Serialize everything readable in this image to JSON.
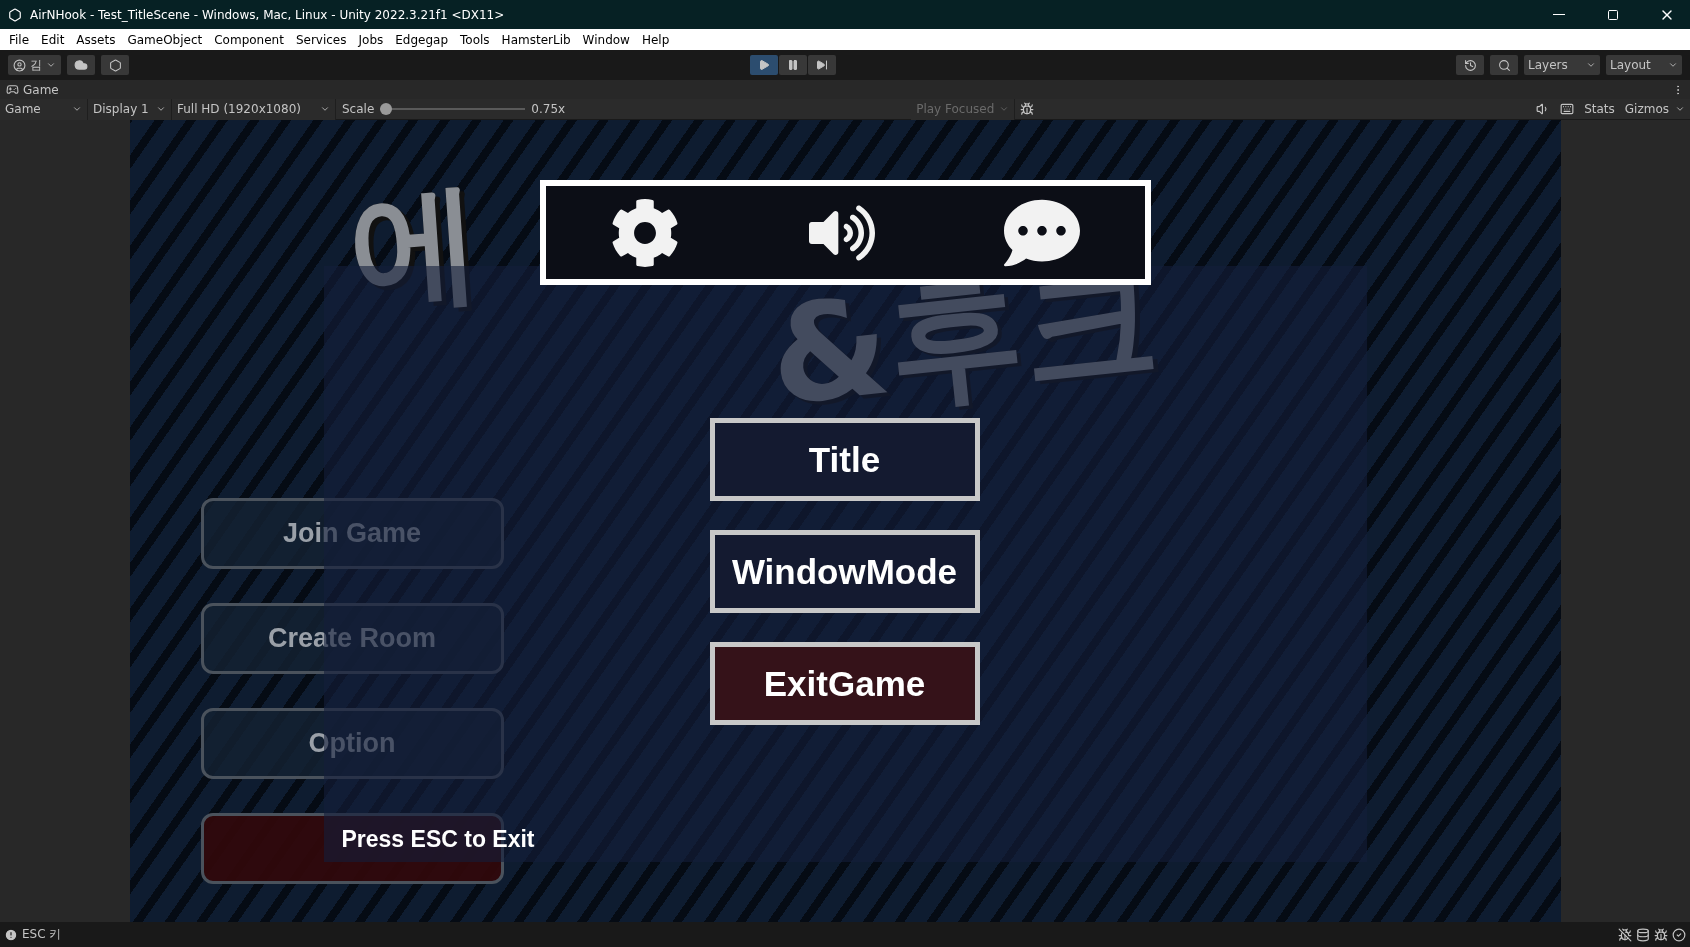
{
  "window": {
    "title": "AirNHook - Test_TitleScene - Windows, Mac, Linux - Unity 2022.3.21f1 <DX11>"
  },
  "menu": [
    "File",
    "Edit",
    "Assets",
    "GameObject",
    "Component",
    "Services",
    "Jobs",
    "Edgegap",
    "Tools",
    "HamsterLib",
    "Window",
    "Help"
  ],
  "toolbar": {
    "account": "김",
    "play_controls": [
      {
        "kind": "play",
        "selected": true
      },
      {
        "kind": "pause",
        "selected": false
      },
      {
        "kind": "step",
        "selected": false
      }
    ],
    "layers": "Layers",
    "layout": "Layout"
  },
  "game_tab": {
    "title": "Game"
  },
  "game_toolbar": {
    "view": "Game",
    "display": "Display 1",
    "resolution": "Full HD (1920x1080)",
    "scale_label": "Scale",
    "scale": {
      "level": 0
    },
    "scale_reading": "0.75x",
    "play_mode": {
      "label": "Play Focused",
      "disabled": true
    },
    "stats": "Stats",
    "gizmos": "Gizmos"
  },
  "game": {
    "logo": [
      "에",
      "&후크"
    ],
    "side_menu": [
      {
        "kind": "normal",
        "label": "Join Game"
      },
      {
        "kind": "normal",
        "label": "Create Room"
      },
      {
        "kind": "normal",
        "label": "Option"
      },
      {
        "kind": "danger"
      }
    ],
    "icon_panel": [
      {
        "kind": "settings"
      },
      {
        "kind": "sound"
      },
      {
        "kind": "chat"
      }
    ],
    "pause_menu": [
      {
        "label": "Title",
        "kind": "normal"
      },
      {
        "label": "WindowMode",
        "kind": "normal"
      },
      {
        "label": "ExitGame",
        "kind": "danger"
      }
    ],
    "hint": "Press ESC to Exit"
  },
  "status_bar": {
    "message": "ESC 키"
  }
}
